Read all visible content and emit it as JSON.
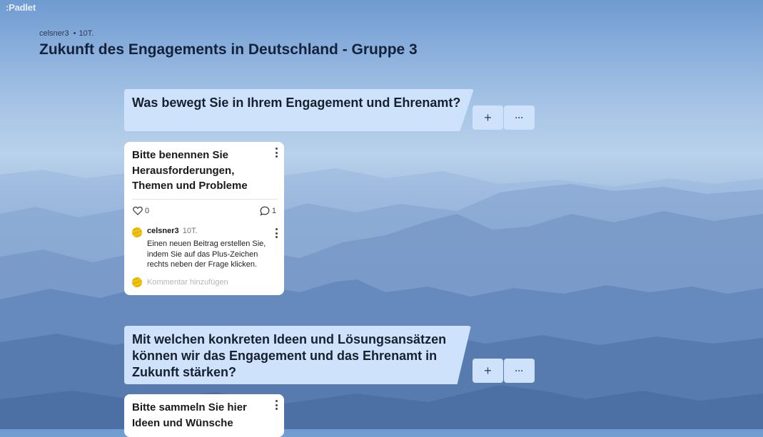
{
  "app": {
    "logo": ":Padlet"
  },
  "board": {
    "author": "celsner3",
    "age": "10T.",
    "title": "Zukunft des Engagements in Deutschland - Gruppe 3"
  },
  "sections": [
    {
      "title": "Was bewegt Sie in Ihrem Engagement und Ehrenamt?",
      "add_label": "+",
      "more_label": "···"
    },
    {
      "title": "Mit welchen konkreten Ideen und Lösungsansätzen können wir das Engagement und das Ehrenamt in Zukunft stärken?",
      "add_label": "+",
      "more_label": "···"
    }
  ],
  "posts": [
    {
      "title": "Bitte benennen Sie Herausforderungen, Themen und Probleme",
      "likes": "0",
      "comments_count": "1",
      "comment": {
        "author": "celsner3",
        "age": "10T.",
        "text": "Einen neuen Beitrag erstellen Sie, indem Sie auf das Plus-Zeichen rechts neben der Frage klicken."
      },
      "comment_placeholder": "Kommentar hinzufügen"
    },
    {
      "title": "Bitte sammeln Sie hier Ideen und Wünsche"
    }
  ],
  "icons": {
    "like": "heart-icon",
    "comment": "comment-bubble-icon",
    "more": "kebab-menu-icon",
    "avatar": "user-avatar"
  }
}
